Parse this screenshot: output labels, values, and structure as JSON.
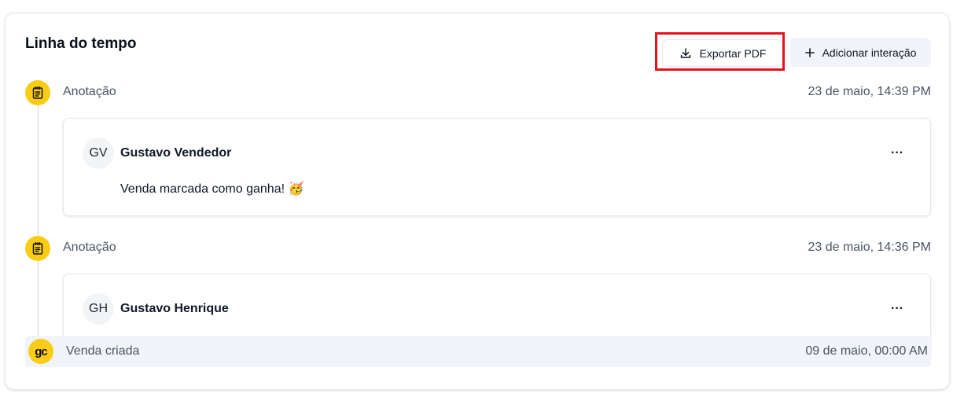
{
  "header": {
    "title": "Linha do tempo",
    "export_label": "Exportar PDF",
    "add_label": "Adicionar interação"
  },
  "events": [
    {
      "type_label": "Anotação",
      "date": "23 de maio, 14:39 PM",
      "author_initials": "GV",
      "author_name": "Gustavo Vendedor",
      "text": "Venda marcada como ganha! 🥳"
    },
    {
      "type_label": "Anotação",
      "date": "23 de maio, 14:36 PM",
      "author_initials": "GH",
      "author_name": "Gustavo Henrique"
    }
  ],
  "created": {
    "logo_text": "gc",
    "label": "Venda criada",
    "date": "09 de maio, 00:00 AM"
  },
  "more_glyph": "···",
  "colors": {
    "accent_yellow": "#facc15",
    "highlight_red": "#e3131b",
    "muted_text": "#4b5563",
    "row_bg": "#f1f4f8"
  }
}
